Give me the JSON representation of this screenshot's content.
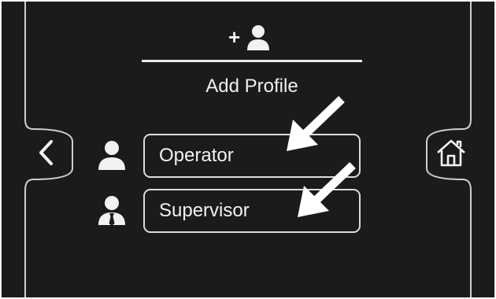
{
  "header": {
    "add_icon_glyph": "+",
    "title": "Add Profile"
  },
  "profiles": [
    {
      "label": "Operator",
      "icon": "operator-person-icon"
    },
    {
      "label": "Supervisor",
      "icon": "supervisor-tie-icon"
    }
  ],
  "nav": {
    "back_icon": "chevron-left-icon",
    "home_icon": "home-icon"
  },
  "colors": {
    "background": "#1b1b1b",
    "foreground": "#efefef",
    "annotation_arrow": "#ffffff"
  }
}
